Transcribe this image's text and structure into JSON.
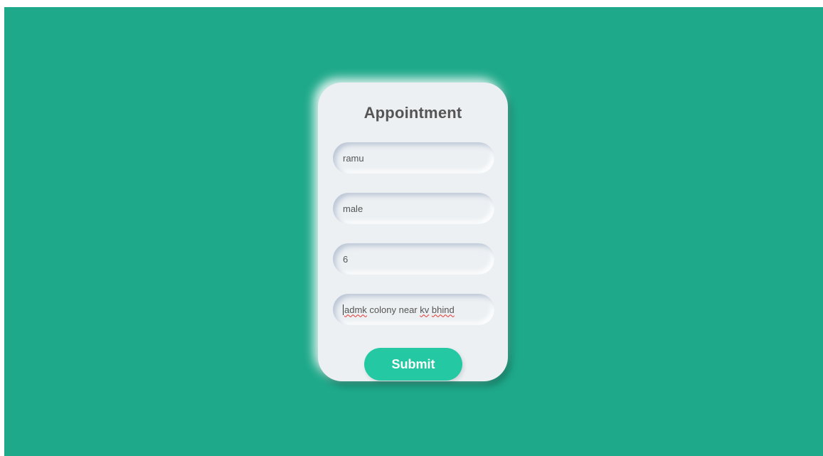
{
  "colors": {
    "background": "#1ea98a",
    "card": "#ecf0f3",
    "accent": "#24c9a3",
    "text": "#555555"
  },
  "form": {
    "title": "Appointment",
    "fields": [
      {
        "value": "ramu"
      },
      {
        "value": "male"
      },
      {
        "value": "6"
      },
      {
        "value": "admk colony near kv bhind",
        "parts": [
          "admk",
          "colony near",
          "kv",
          "bhind"
        ]
      }
    ],
    "submit_label": "Submit"
  }
}
